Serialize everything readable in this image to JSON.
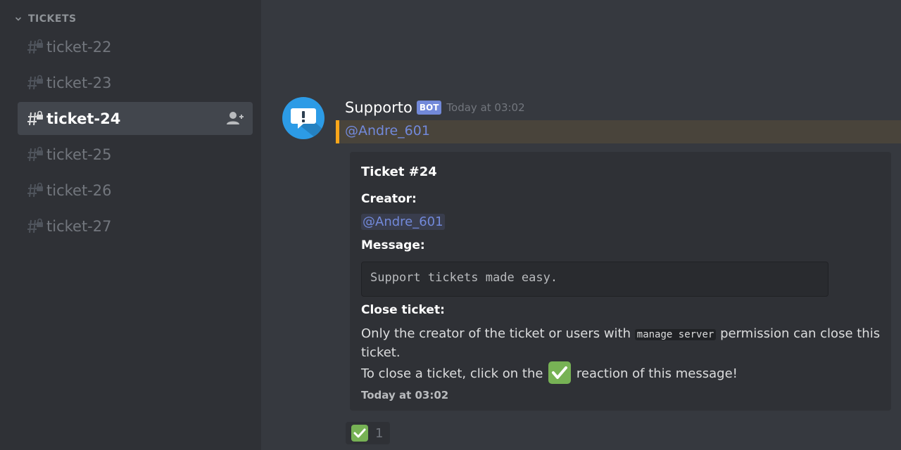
{
  "sidebar": {
    "category": {
      "label": "TICKETS",
      "icon": "chevron-down-icon"
    },
    "channels": [
      {
        "name": "ticket-22",
        "icon": "locked-text-channel-icon"
      },
      {
        "name": "ticket-23",
        "icon": "locked-text-channel-icon"
      },
      {
        "name": "ticket-24",
        "icon": "locked-text-channel-icon",
        "active": true,
        "action_icon": "add-member-icon"
      },
      {
        "name": "ticket-25",
        "icon": "locked-text-channel-icon"
      },
      {
        "name": "ticket-26",
        "icon": "locked-text-channel-icon"
      },
      {
        "name": "ticket-27",
        "icon": "locked-text-channel-icon"
      }
    ]
  },
  "message": {
    "author": "Supporto",
    "bot_tag": "BOT",
    "timestamp": "Today at 03:02",
    "mention": "@Andre_601",
    "embed": {
      "title": "Ticket #24",
      "creator_label": "Creator:",
      "creator_value": "@Andre_601",
      "message_label": "Message:",
      "message_value": "Support tickets made easy.",
      "close_label": "Close ticket:",
      "close_text_1": "Only the creator of the ticket or users with",
      "close_code": "manage server",
      "close_text_2": "permission can close this ticket.",
      "close_text_3": "To close a ticket, click on the",
      "close_text_4": "reaction of this message!",
      "footer": "Today at 03:02"
    },
    "reaction": {
      "emoji": "white-check-mark-icon",
      "count": "1"
    }
  },
  "colors": {
    "sidebar_bg": "#2f3136",
    "chat_bg": "#36393f",
    "accent": "#7289da",
    "mention_highlight": "#faa61a",
    "check_green": "#77b255"
  }
}
